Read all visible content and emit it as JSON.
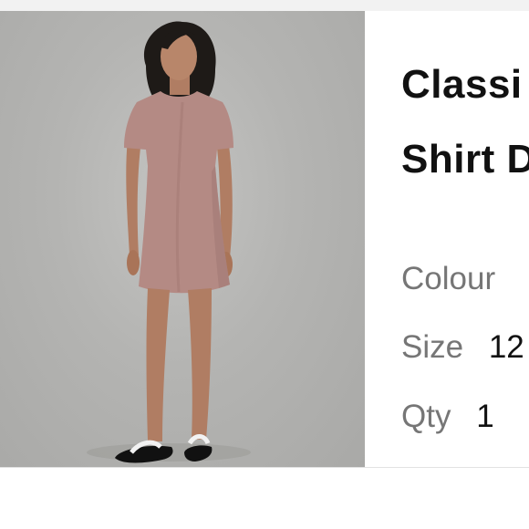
{
  "product": {
    "title_line1": "Classi",
    "title_line2": "Shirt D",
    "image_icon": "product-photo"
  },
  "attributes": {
    "colour_label": "Colour",
    "colour_value": "",
    "size_label": "Size",
    "size_value": "12",
    "qty_label": "Qty",
    "qty_value": "1"
  },
  "colors": {
    "photo_background": "#b4b4b2",
    "dress": "#b48a84",
    "title_text": "#111111",
    "label_text": "#767676"
  }
}
